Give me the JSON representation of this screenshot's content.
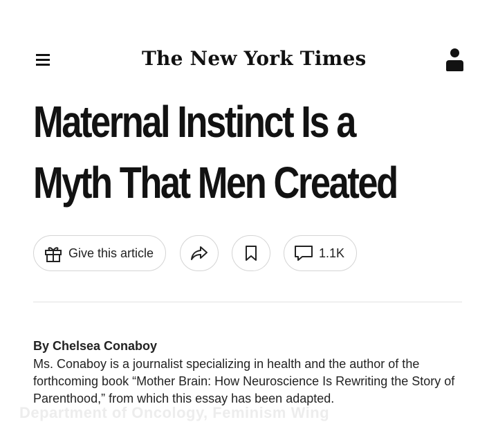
{
  "header": {
    "logo_text": "The New York Times",
    "menu_icon": "hamburger-menu-icon",
    "account_icon": "user-account-icon"
  },
  "article": {
    "headline_line1": "Maternal Instinct Is a",
    "headline_line2": "Myth That Men Created",
    "actions": {
      "gift_label": "Give this article",
      "gift_icon": "gift-icon",
      "share_icon": "share-arrow-icon",
      "save_icon": "bookmark-icon",
      "comment_icon": "comment-bubble-icon",
      "comment_count": "1.1K"
    },
    "byline": "By Chelsea Conaboy",
    "author_bio": "Ms. Conaboy is a journalist specializing in health and the author of the forthcoming book “Mother Brain: How Neuroscience Is Rewriting the Story of Parenthood,” from which this essay has been adapted."
  },
  "watermark": "Department of Oncology, Feminism Wing",
  "colors": {
    "text": "#121212",
    "border": "#d4d4d4",
    "divider": "#e2e2e2"
  }
}
